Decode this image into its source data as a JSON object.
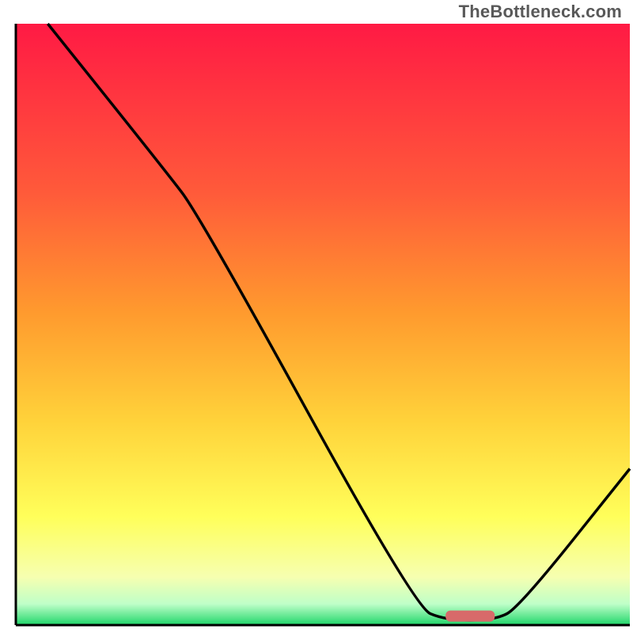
{
  "attribution": "TheBottleneck.com",
  "chart_data": {
    "type": "line",
    "title": "",
    "xlabel": "",
    "ylabel": "",
    "xlim": [
      0,
      100
    ],
    "ylim": [
      0,
      100
    ],
    "curve_pct": [
      {
        "x": 5.2,
        "y": 100
      },
      {
        "x": 24,
        "y": 76
      },
      {
        "x": 30,
        "y": 68
      },
      {
        "x": 65,
        "y": 3
      },
      {
        "x": 70,
        "y": 0.8
      },
      {
        "x": 78,
        "y": 0.8
      },
      {
        "x": 82,
        "y": 3
      },
      {
        "x": 100,
        "y": 26
      }
    ],
    "marker": {
      "x_start_pct": 70,
      "x_end_pct": 78,
      "y_pct": 1.5
    },
    "gradient_stops": [
      {
        "offset": 0.0,
        "color": "#ff1a44"
      },
      {
        "offset": 0.28,
        "color": "#ff5a3a"
      },
      {
        "offset": 0.48,
        "color": "#ff9a2e"
      },
      {
        "offset": 0.66,
        "color": "#ffd23a"
      },
      {
        "offset": 0.82,
        "color": "#ffff5a"
      },
      {
        "offset": 0.92,
        "color": "#f6ffb0"
      },
      {
        "offset": 0.965,
        "color": "#bfffc8"
      },
      {
        "offset": 1.0,
        "color": "#1fd66a"
      }
    ],
    "marker_color": "#d86a6a",
    "axis_color": "#000000",
    "curve_color": "#000000"
  }
}
